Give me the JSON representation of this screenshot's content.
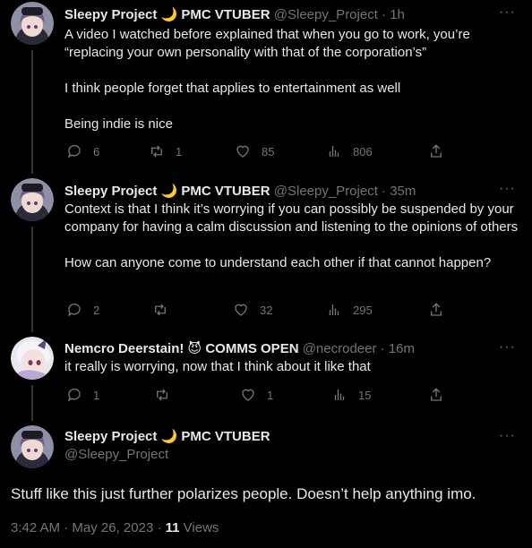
{
  "tweets": [
    {
      "name": "Sleepy Project 🌙 PMC VTUBER",
      "handle": "@Sleepy_Project",
      "time": "1h",
      "paragraphs": [
        "A video I watched before explained that when you go to work, you’re “replacing your own personality with that of the corporation’s”",
        "I think people forget that applies to entertainment as well",
        "Being indie is nice"
      ],
      "replies": "6",
      "reposts": "1",
      "likes": "85",
      "views": "806"
    },
    {
      "name": "Sleepy Project 🌙 PMC VTUBER",
      "handle": "@Sleepy_Project",
      "time": "35m",
      "paragraphs": [
        "Context is that I think it’s worrying if you can possibly be suspended by your company for having a calm discussion and listening to the opinions of others",
        "How can anyone come to understand each other if that cannot happen?"
      ],
      "replies": "2",
      "reposts": "",
      "likes": "32",
      "views": "295"
    },
    {
      "name": "Nemcro Deerstain! 😈 COMMS OPEN",
      "handle": "@necrodeer",
      "time": "16m",
      "paragraphs": [
        "it really is worrying, now that I think about it like that"
      ],
      "replies": "1",
      "reposts": "",
      "likes": "1",
      "views": "15"
    }
  ],
  "main_tweet": {
    "name": "Sleepy Project 🌙 PMC VTUBER",
    "handle": "@Sleepy_Project",
    "text": "Stuff like this just further polarizes people. Doesn’t help anything imo.",
    "time": "3:42 AM",
    "date": "May 26, 2023",
    "views_count": "11",
    "views_label": "Views"
  },
  "ui": {
    "separator": "·",
    "more": "···"
  },
  "colors": {
    "background": "#000000",
    "text": "#e7e9ea",
    "muted": "#71767b",
    "thread_line": "#333639"
  }
}
